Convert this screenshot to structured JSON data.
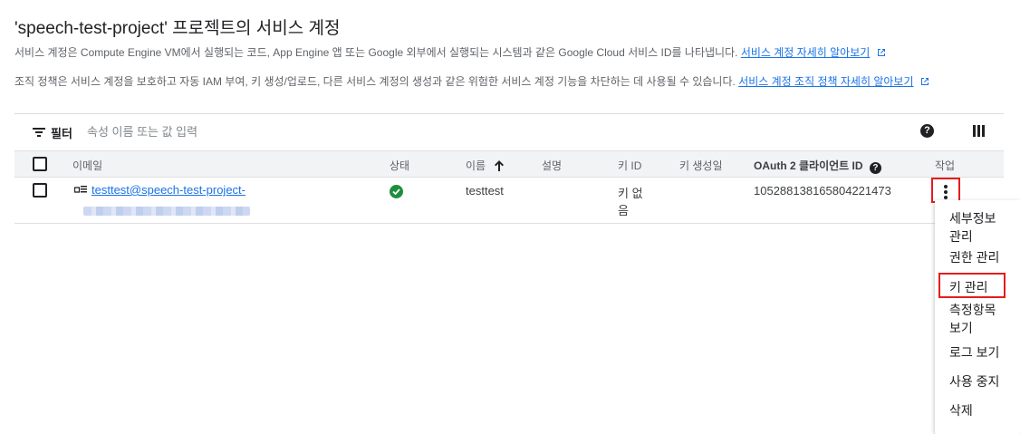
{
  "page": {
    "title": "'speech-test-project' 프로젝트의 서비스 계정",
    "description1": "서비스 계정은 Compute Engine VM에서 실행되는 코드, App Engine 앱 또는 Google 외부에서 실행되는 시스템과 같은 Google Cloud 서비스 ID를 나타냅니다.",
    "description1_link": "서비스 계정 자세히 알아보기",
    "description2": "조직 정책은 서비스 계정을 보호하고 자동 IAM 부여, 키 생성/업로드, 다른 서비스 계정의 생성과 같은 위험한 서비스 계정 기능을 차단하는 데 사용될 수 있습니다.",
    "description2_link": "서비스 계정 조직 정책 자세히 알아보기"
  },
  "filter": {
    "label": "필터",
    "placeholder": "속성 이름 또는 값 입력"
  },
  "table": {
    "headers": {
      "email": "이메일",
      "status": "상태",
      "name": "이름",
      "description": "설명",
      "key_id": "키 ID",
      "key_created": "키 생성일",
      "oauth_client_id": "OAuth 2 클라이언트 ID",
      "actions": "작업"
    },
    "rows": [
      {
        "email": "testtest@speech-test-project-",
        "status": "enabled",
        "name": "testtest",
        "description": "",
        "key_id_line1": "키 없",
        "key_id_line2": "음",
        "key_created": "",
        "oauth_client_id": "105288138165804221473"
      }
    ]
  },
  "actions_menu": {
    "items": [
      {
        "label_line1": "세부정보",
        "label_line2": "관리"
      },
      {
        "label_line1": "권한 관리",
        "label_line2": ""
      },
      {
        "label_line1": "키 관리",
        "label_line2": ""
      },
      {
        "label_line1": "측정항목",
        "label_line2": "보기"
      },
      {
        "label_line1": "로그 보기",
        "label_line2": ""
      },
      {
        "label_line1": "사용 중지",
        "label_line2": ""
      },
      {
        "label_line1": "삭제",
        "label_line2": ""
      }
    ],
    "highlighted_item": "키 관리"
  },
  "colors": {
    "link": "#1a73e8",
    "status_ok": "#1e8e3e",
    "highlight_border": "#e51c1c",
    "header_bg": "#f1f3f4"
  },
  "icons": {
    "filter": "filter-list-icon",
    "help": "help-circle-icon",
    "columns": "column-display-icon",
    "service_account": "service-account-key-icon",
    "status": "check-circle-icon",
    "sort": "arrow-upward-icon",
    "more": "more-vert-icon",
    "external": "open-in-new-icon"
  }
}
